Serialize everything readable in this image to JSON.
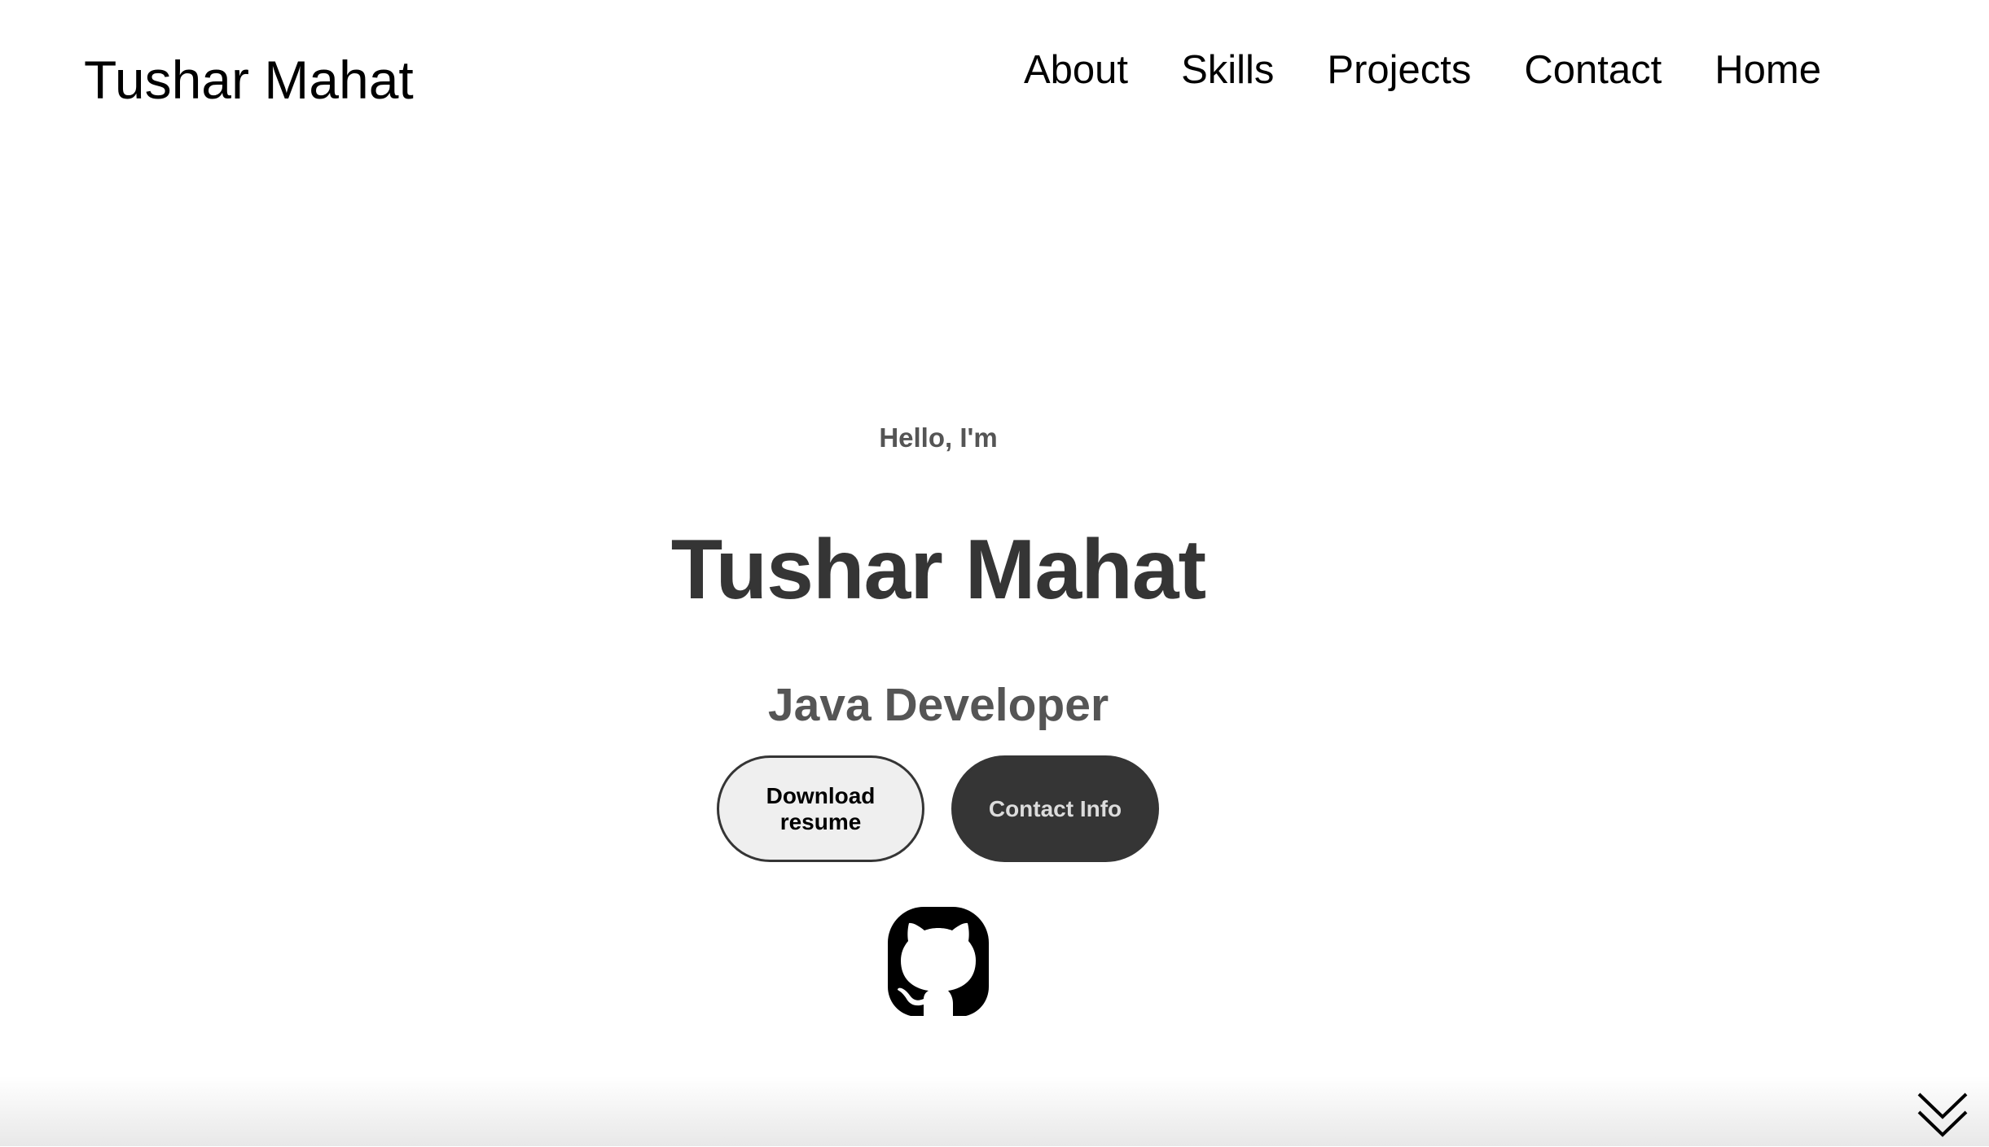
{
  "nav": {
    "logo": "Tushar Mahat",
    "links": [
      "About",
      "Skills",
      "Projects",
      "Contact",
      "Home"
    ]
  },
  "hero": {
    "greeting": "Hello, I'm",
    "name": "Tushar Mahat",
    "title": "Java Developer",
    "buttons": {
      "resume": "Download resume",
      "contact": "Contact Info"
    },
    "social": [
      "github-icon"
    ]
  },
  "scroll": {
    "icon": "double-chevron-down-icon"
  },
  "colors": {
    "text_dark": "#353535",
    "text_muted": "#555555",
    "button_light_bg": "#efefef",
    "button_dark_bg": "#353535"
  }
}
